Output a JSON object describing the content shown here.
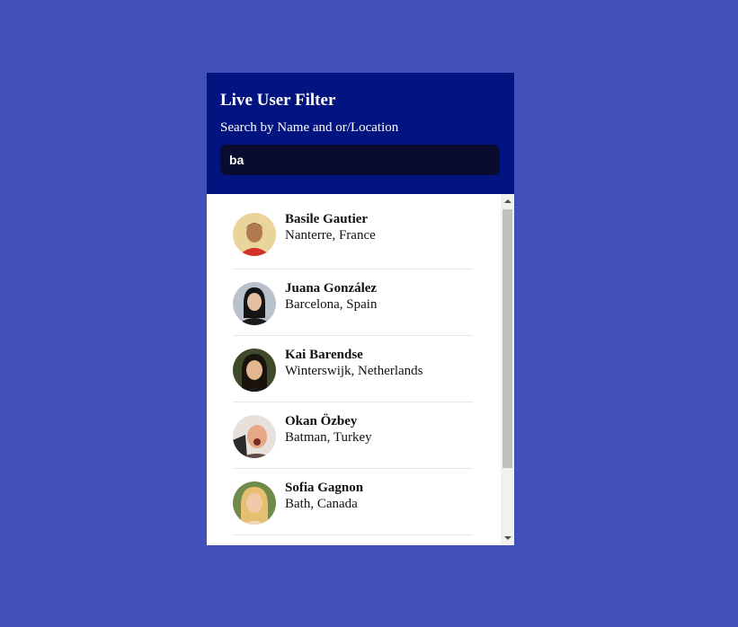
{
  "header": {
    "title": "Live User Filter",
    "subtitle": "Search by Name and or/Location"
  },
  "search": {
    "value": "ba"
  },
  "users": [
    {
      "name": "Basile Gautier",
      "location": "Nanterre, France"
    },
    {
      "name": "Juana González",
      "location": "Barcelona, Spain"
    },
    {
      "name": "Kai Barendse",
      "location": "Winterswijk, Netherlands"
    },
    {
      "name": "Okan Özbey",
      "location": "Batman, Turkey"
    },
    {
      "name": "Sofia Gagnon",
      "location": "Bath, Canada"
    }
  ],
  "colors": {
    "page_background": "#4151b7",
    "header_background": "#021480",
    "input_background": "#090c2e"
  }
}
